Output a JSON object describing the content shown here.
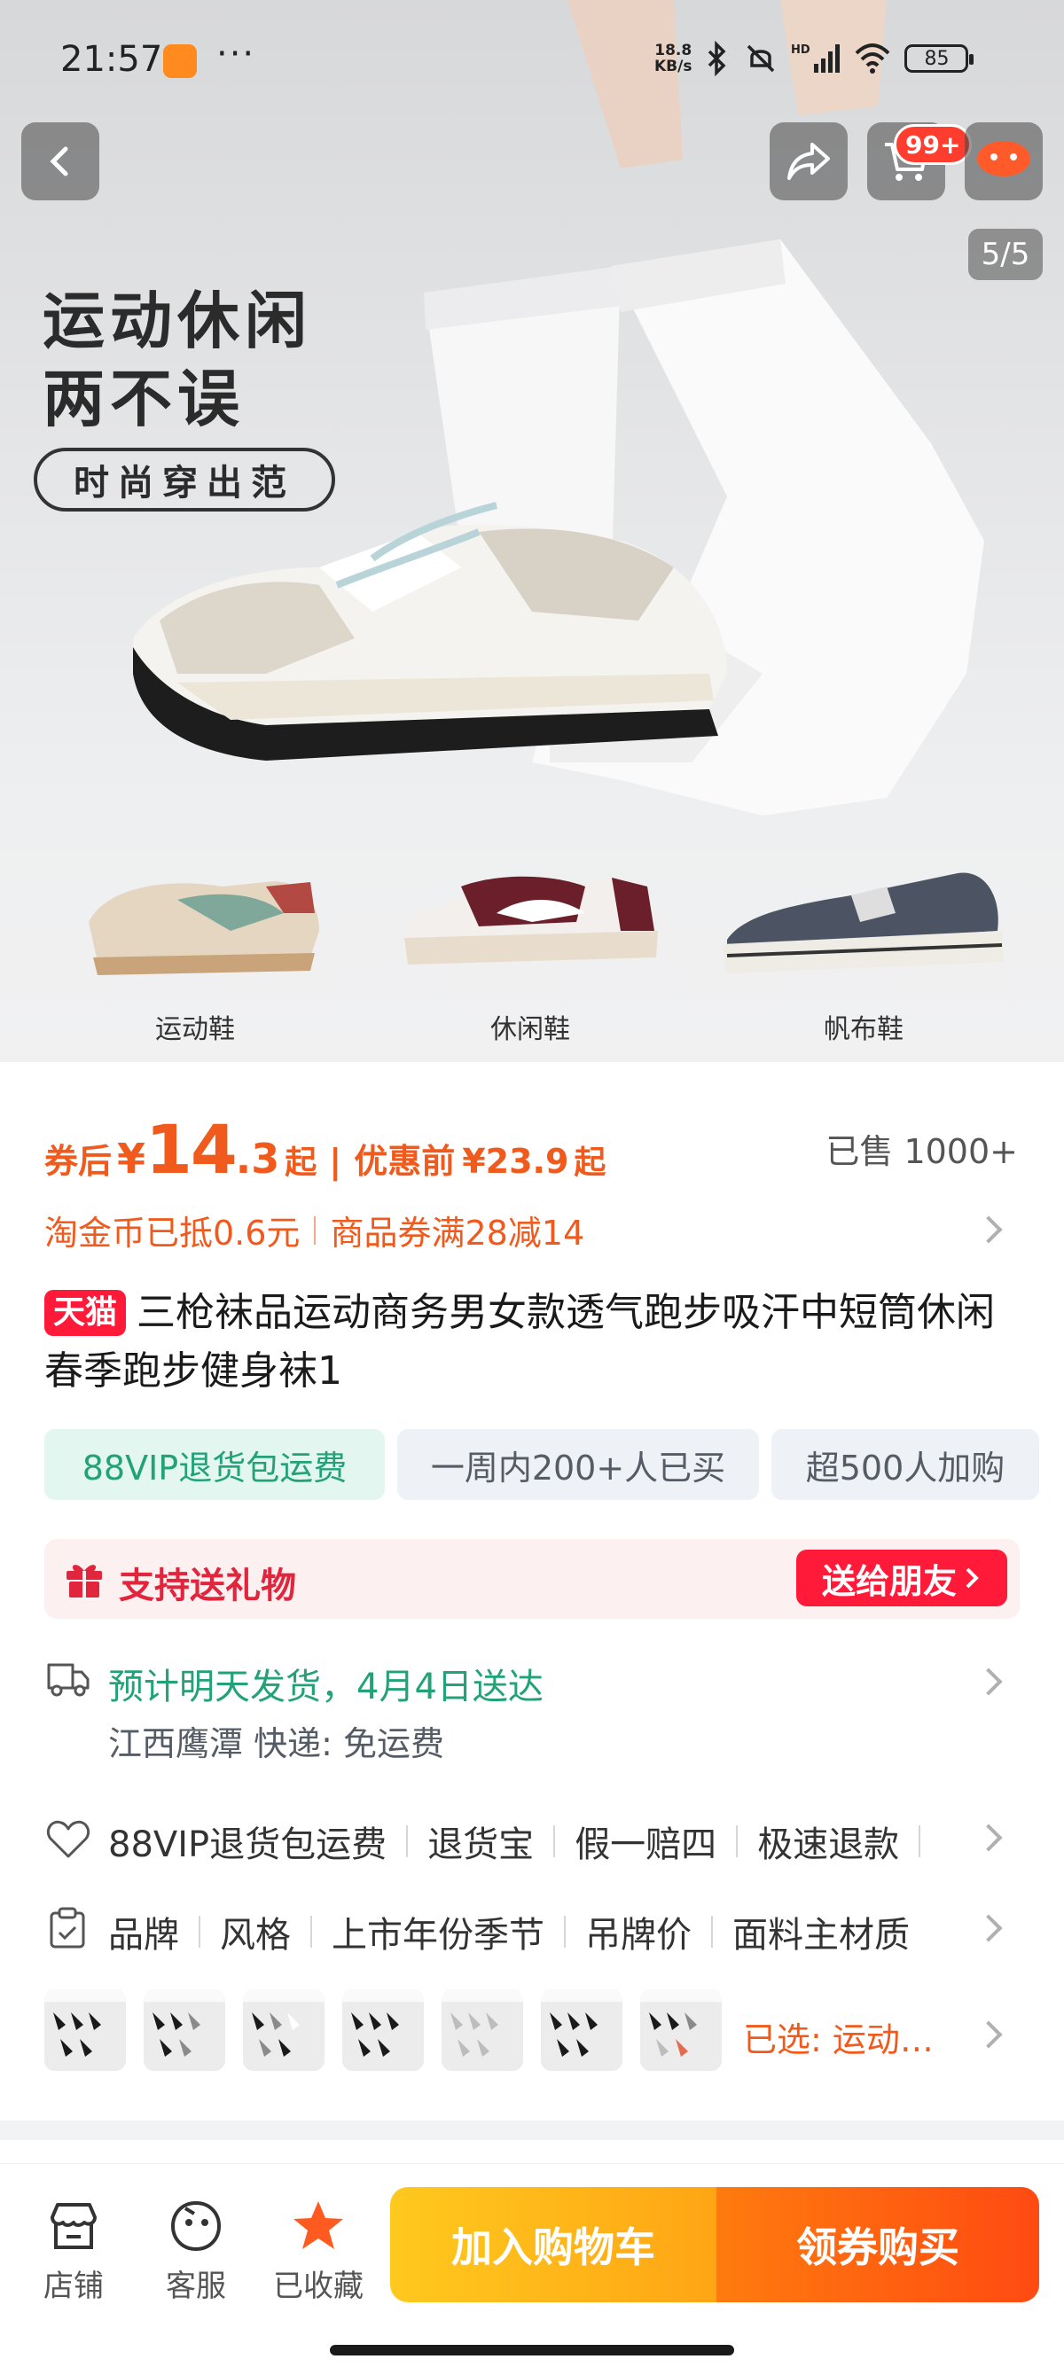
{
  "status_bar": {
    "time": "21:57",
    "dots": "···",
    "net_speed_value": "18.8",
    "net_speed_unit": "KB/s",
    "battery": "85"
  },
  "hero": {
    "title_line1": "运动休闲",
    "title_line2": "两不误",
    "tag": "时尚穿出范",
    "pager": "5/5",
    "cart_badge": "99+",
    "shoe_labels": [
      "运动鞋",
      "休闲鞋",
      "帆布鞋"
    ]
  },
  "price": {
    "after_coupon_label": "券后",
    "currency": "¥",
    "integer": "14",
    "decimal": ".3",
    "qi": "起",
    "separator": "|",
    "before_discount_label": "优惠前",
    "original_price": "¥23.9",
    "original_qi": "起",
    "sold": "已售 1000+"
  },
  "coins": {
    "coin_text": "淘金币已抵0.6元",
    "coupon_text": "商品券满28减14"
  },
  "product": {
    "store_badge": "天猫",
    "title": "三枪袜品运动商务男女款透气跑步吸汗中短筒休闲春季跑步健身袜1"
  },
  "chips": [
    "88VIP退货包运费",
    "一周内200+人已买",
    "超500人加购"
  ],
  "gift": {
    "label": "支持送礼物",
    "button": "送给朋友"
  },
  "delivery": {
    "main": "预计明天发货，4月4日送达",
    "sub": "江西鹰潭  快递: 免运费"
  },
  "services": [
    "88VIP退货包运费",
    "退货宝",
    "假一赔四",
    "极速退款"
  ],
  "params": [
    "品牌",
    "风格",
    "上市年份季节",
    "吊牌价",
    "面料主材质"
  ],
  "sku": {
    "selected": "已选: 运动…"
  },
  "bottom_bar": {
    "tabs": [
      "店铺",
      "客服",
      "已收藏"
    ],
    "add_to_cart": "加入购物车",
    "buy": "领券购买"
  },
  "colors": {
    "accent_orange": "#f05a1d",
    "tmall_red": "#ff1a3a",
    "green": "#23a277"
  }
}
